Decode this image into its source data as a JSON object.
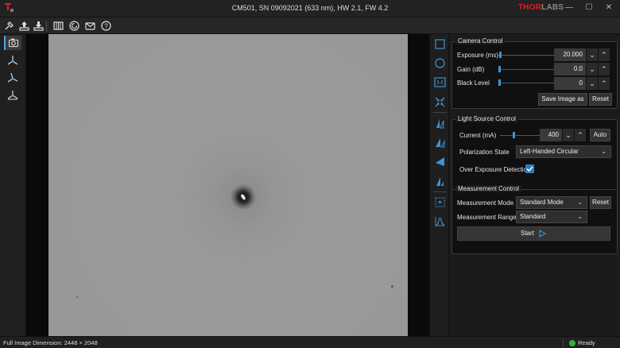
{
  "window": {
    "title": "CM501, SN 09092021 (633 nm), HW 2.1, FW 4.2",
    "brand_red": "THOR",
    "brand_gray": "LABS",
    "controls": {
      "minimize": "—",
      "maximize": "☐",
      "close": "✕"
    }
  },
  "camera_control": {
    "title": "Camera Control",
    "exposure": {
      "label": "Exposure (ms)",
      "value": "20.000",
      "slider_fraction": 0.02
    },
    "gain": {
      "label": "Gain (dB)",
      "value": "0.0",
      "slider_fraction": 0.0
    },
    "black_level": {
      "label": "Black Level",
      "value": "0",
      "slider_fraction": 0.0
    },
    "save_label": "Save Image as",
    "reset_label": "Reset"
  },
  "light_source_control": {
    "title": "Light Source Control",
    "current": {
      "label": "Current (mA)",
      "value": "400",
      "slider_fraction": 0.35
    },
    "auto_label": "Auto",
    "polarization": {
      "label": "Polarization State",
      "value": "Left-Handed Circular"
    },
    "over_exposure": {
      "label": "Over Exposure Detection",
      "checked": true
    }
  },
  "measurement_control": {
    "title": "Measurement Control",
    "mode": {
      "label": "Measurement Mode",
      "value": "Standard Mode"
    },
    "range": {
      "label": "Measurement Range",
      "value": "Standard"
    },
    "reset_label": "Reset",
    "start_label": "Start"
  },
  "status": {
    "dimension": "Full Image Dimension: 2448 × 2048",
    "state": "Ready",
    "state_color": "#2fb53a"
  },
  "colors": {
    "accent": "#3d94d6",
    "brand_red": "#d3222a"
  }
}
